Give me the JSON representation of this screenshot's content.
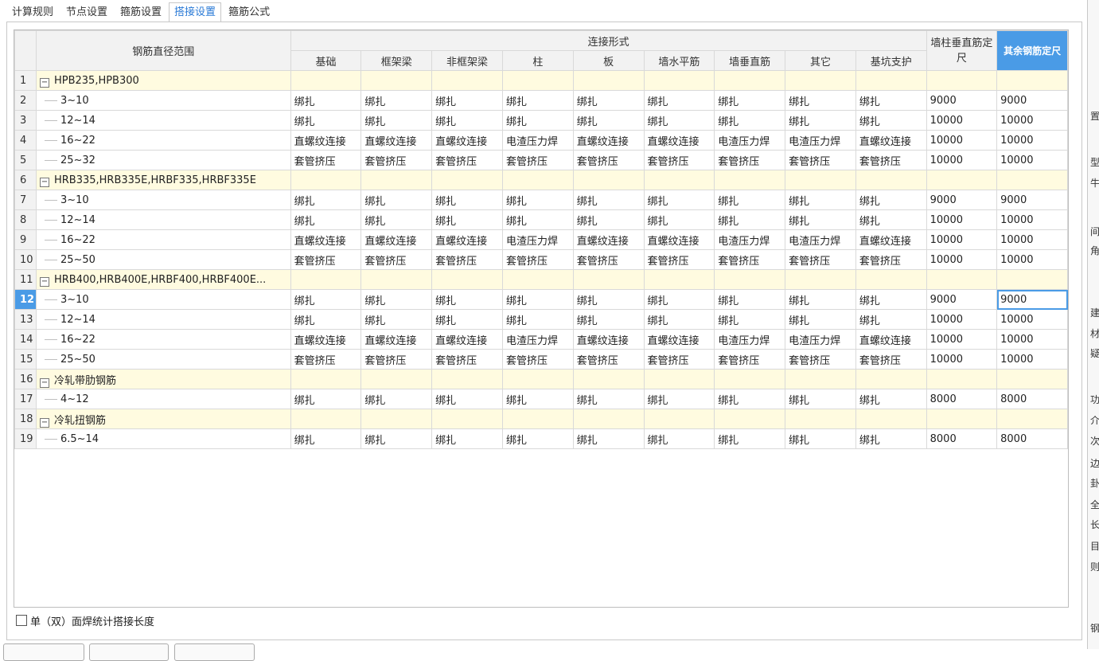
{
  "tabs": [
    {
      "label": "计算规则",
      "active": false
    },
    {
      "label": "节点设置",
      "active": false
    },
    {
      "label": "箍筋设置",
      "active": false
    },
    {
      "label": "搭接设置",
      "active": true
    },
    {
      "label": "箍筋公式",
      "active": false
    }
  ],
  "table": {
    "header": {
      "diameter_range": "钢筋直径范围",
      "connection_group": "连接形式",
      "wall_col_vertical": "墙柱垂直筋定尺",
      "other_fixed": "其余钢筋定尺",
      "connection_cols": [
        "基础",
        "框架梁",
        "非框架梁",
        "柱",
        "板",
        "墙水平筋",
        "墙垂直筋",
        "其它",
        "基坑支护"
      ]
    },
    "rows": [
      {
        "num": "1",
        "group": true,
        "name": "HPB235,HPB300"
      },
      {
        "num": "2",
        "name": "3~10",
        "vals": [
          "绑扎",
          "绑扎",
          "绑扎",
          "绑扎",
          "绑扎",
          "绑扎",
          "绑扎",
          "绑扎",
          "绑扎"
        ],
        "fixed1": "9000",
        "fixed2": "9000"
      },
      {
        "num": "3",
        "name": "12~14",
        "vals": [
          "绑扎",
          "绑扎",
          "绑扎",
          "绑扎",
          "绑扎",
          "绑扎",
          "绑扎",
          "绑扎",
          "绑扎"
        ],
        "fixed1": "10000",
        "fixed2": "10000"
      },
      {
        "num": "4",
        "name": "16~22",
        "vals": [
          "直螺纹连接",
          "直螺纹连接",
          "直螺纹连接",
          "电渣压力焊",
          "直螺纹连接",
          "直螺纹连接",
          "电渣压力焊",
          "电渣压力焊",
          "直螺纹连接"
        ],
        "fixed1": "10000",
        "fixed2": "10000"
      },
      {
        "num": "5",
        "name": "25~32",
        "vals": [
          "套管挤压",
          "套管挤压",
          "套管挤压",
          "套管挤压",
          "套管挤压",
          "套管挤压",
          "套管挤压",
          "套管挤压",
          "套管挤压"
        ],
        "fixed1": "10000",
        "fixed2": "10000"
      },
      {
        "num": "6",
        "group": true,
        "name": "HRB335,HRB335E,HRBF335,HRBF335E"
      },
      {
        "num": "7",
        "name": "3~10",
        "vals": [
          "绑扎",
          "绑扎",
          "绑扎",
          "绑扎",
          "绑扎",
          "绑扎",
          "绑扎",
          "绑扎",
          "绑扎"
        ],
        "fixed1": "9000",
        "fixed2": "9000"
      },
      {
        "num": "8",
        "name": "12~14",
        "vals": [
          "绑扎",
          "绑扎",
          "绑扎",
          "绑扎",
          "绑扎",
          "绑扎",
          "绑扎",
          "绑扎",
          "绑扎"
        ],
        "fixed1": "10000",
        "fixed2": "10000"
      },
      {
        "num": "9",
        "name": "16~22",
        "vals": [
          "直螺纹连接",
          "直螺纹连接",
          "直螺纹连接",
          "电渣压力焊",
          "直螺纹连接",
          "直螺纹连接",
          "电渣压力焊",
          "电渣压力焊",
          "直螺纹连接"
        ],
        "fixed1": "10000",
        "fixed2": "10000"
      },
      {
        "num": "10",
        "name": "25~50",
        "vals": [
          "套管挤压",
          "套管挤压",
          "套管挤压",
          "套管挤压",
          "套管挤压",
          "套管挤压",
          "套管挤压",
          "套管挤压",
          "套管挤压"
        ],
        "fixed1": "10000",
        "fixed2": "10000"
      },
      {
        "num": "11",
        "group": true,
        "name": "HRB400,HRB400E,HRBF400,HRBF400E..."
      },
      {
        "num": "12",
        "selected": true,
        "name": "3~10",
        "vals": [
          "绑扎",
          "绑扎",
          "绑扎",
          "绑扎",
          "绑扎",
          "绑扎",
          "绑扎",
          "绑扎",
          "绑扎"
        ],
        "fixed1": "9000",
        "fixed2": "9000"
      },
      {
        "num": "13",
        "name": "12~14",
        "vals": [
          "绑扎",
          "绑扎",
          "绑扎",
          "绑扎",
          "绑扎",
          "绑扎",
          "绑扎",
          "绑扎",
          "绑扎"
        ],
        "fixed1": "10000",
        "fixed2": "10000"
      },
      {
        "num": "14",
        "name": "16~22",
        "vals": [
          "直螺纹连接",
          "直螺纹连接",
          "直螺纹连接",
          "电渣压力焊",
          "直螺纹连接",
          "直螺纹连接",
          "电渣压力焊",
          "电渣压力焊",
          "直螺纹连接"
        ],
        "fixed1": "10000",
        "fixed2": "10000"
      },
      {
        "num": "15",
        "name": "25~50",
        "vals": [
          "套管挤压",
          "套管挤压",
          "套管挤压",
          "套管挤压",
          "套管挤压",
          "套管挤压",
          "套管挤压",
          "套管挤压",
          "套管挤压"
        ],
        "fixed1": "10000",
        "fixed2": "10000"
      },
      {
        "num": "16",
        "group": true,
        "name": "冷轧带肋钢筋"
      },
      {
        "num": "17",
        "name": "4~12",
        "vals": [
          "绑扎",
          "绑扎",
          "绑扎",
          "绑扎",
          "绑扎",
          "绑扎",
          "绑扎",
          "绑扎",
          "绑扎"
        ],
        "fixed1": "8000",
        "fixed2": "8000"
      },
      {
        "num": "18",
        "group": true,
        "name": "冷轧扭钢筋"
      },
      {
        "num": "19",
        "name": "6.5~14",
        "vals": [
          "绑扎",
          "绑扎",
          "绑扎",
          "绑扎",
          "绑扎",
          "绑扎",
          "绑扎",
          "绑扎",
          "绑扎"
        ],
        "fixed1": "8000",
        "fixed2": "8000"
      }
    ]
  },
  "option": {
    "label": "单（双）面焊统计搭接长度",
    "checked": false
  },
  "right_glyphs": [
    "置",
    "型",
    "牛",
    "间",
    "角",
    "建",
    "材",
    "疑",
    "功",
    "介",
    "次",
    "边",
    "卦",
    "全",
    "长",
    "目",
    "则",
    "钢"
  ],
  "colors": {
    "accent": "#4a9be6",
    "group_row": "#fffbe0",
    "header": "#f2f2f2"
  }
}
